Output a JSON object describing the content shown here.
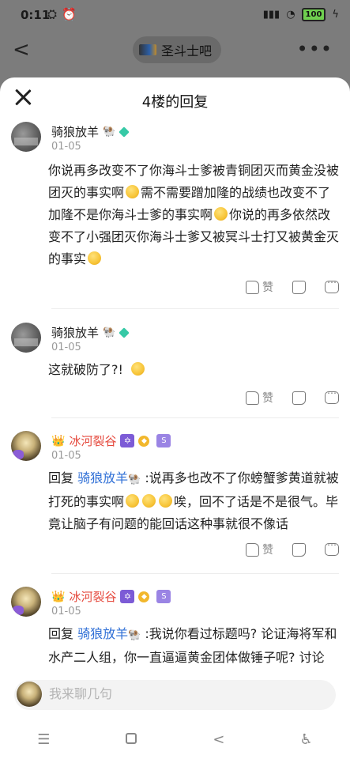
{
  "status": {
    "time": "0:11",
    "battery": "100"
  },
  "header": {
    "forum_name": "圣斗士吧",
    "sheet_title": "4楼的回复"
  },
  "posts": [
    {
      "user": "骑狼放羊",
      "date": "01-05",
      "content_parts": [
        "你说再多改变不了你海斗士爹被青铜团灭而黄金没被团灭的事实啊",
        "需不需要蹭加隆的战绩也改变不了加隆不是你海斗士爹的事实啊",
        "你说的再多依然改变不了小强团灭你海斗士爹又被冥斗士打又被黄金灭的事实"
      ],
      "like_label": "赞"
    },
    {
      "user": "骑狼放羊",
      "date": "01-05",
      "content_parts": [
        "这就破防了?!"
      ],
      "like_label": "赞"
    },
    {
      "user": "冰河裂谷",
      "date": "01-05",
      "reply_prefix": "回复",
      "reply_to": "骑狼放羊",
      "content_parts": [
        " :说再多也改不了你螃蟹爹黄道就被打死的事实啊",
        "唉，回不了话是不是很气。毕竟让脑子有问题的能回话这种事就很不像话"
      ],
      "like_label": "赞"
    },
    {
      "user": "冰河裂谷",
      "date": "01-05",
      "reply_prefix": "回复",
      "reply_to": "骑狼放羊",
      "content_parts": [
        " :我说你看过标题吗? 论证海将军和水产二人组，你一直逼逼黄金团体做锤子呢? 讨论"
      ]
    }
  ],
  "input": {
    "placeholder": "我来聊几句"
  },
  "colors": {
    "vip_name": "#e5483c",
    "mention": "#2f6fd6",
    "date": "#9a9a9a"
  },
  "icons": [
    "close-icon",
    "thumb-up-icon",
    "thumb-down-icon",
    "comment-icon",
    "menu-icon",
    "home-icon",
    "back-icon",
    "accessibility-icon"
  ]
}
